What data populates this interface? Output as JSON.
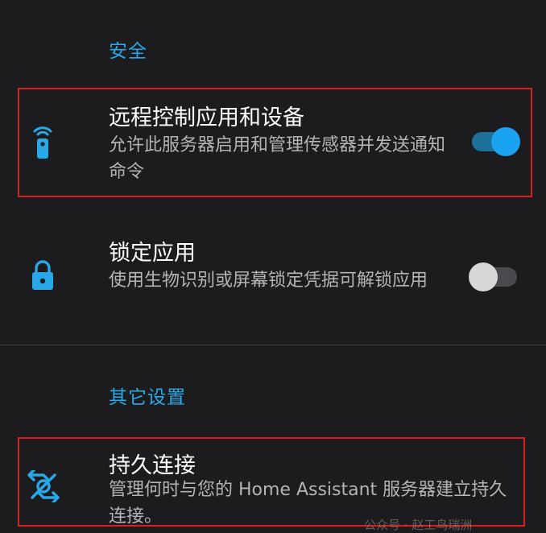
{
  "sections": {
    "security": {
      "header": "安全",
      "remote_control": {
        "title": "远程控制应用和设备",
        "summary": "允许此服务器启用和管理传感器并发送通知命令",
        "enabled": true,
        "icon": "remote-control-icon"
      },
      "app_lock": {
        "title": "锁定应用",
        "summary": "使用生物识别或屏幕锁定凭据可解锁应用",
        "enabled": false,
        "icon": "lock-icon"
      }
    },
    "other": {
      "header": "其它设置",
      "persistent_connection": {
        "title": "持久连接",
        "summary": "管理何时与您的 Home Assistant 服务器建立持久连接。",
        "icon": "persistent-connection-icon"
      }
    }
  },
  "watermark": "公众号 · 赵工鸟瑞洲",
  "colors": {
    "background": "#1c1c1e",
    "accent": "#29a8e8",
    "highlight_border": "#d9201f",
    "switch_on": "#1aa3f0"
  }
}
